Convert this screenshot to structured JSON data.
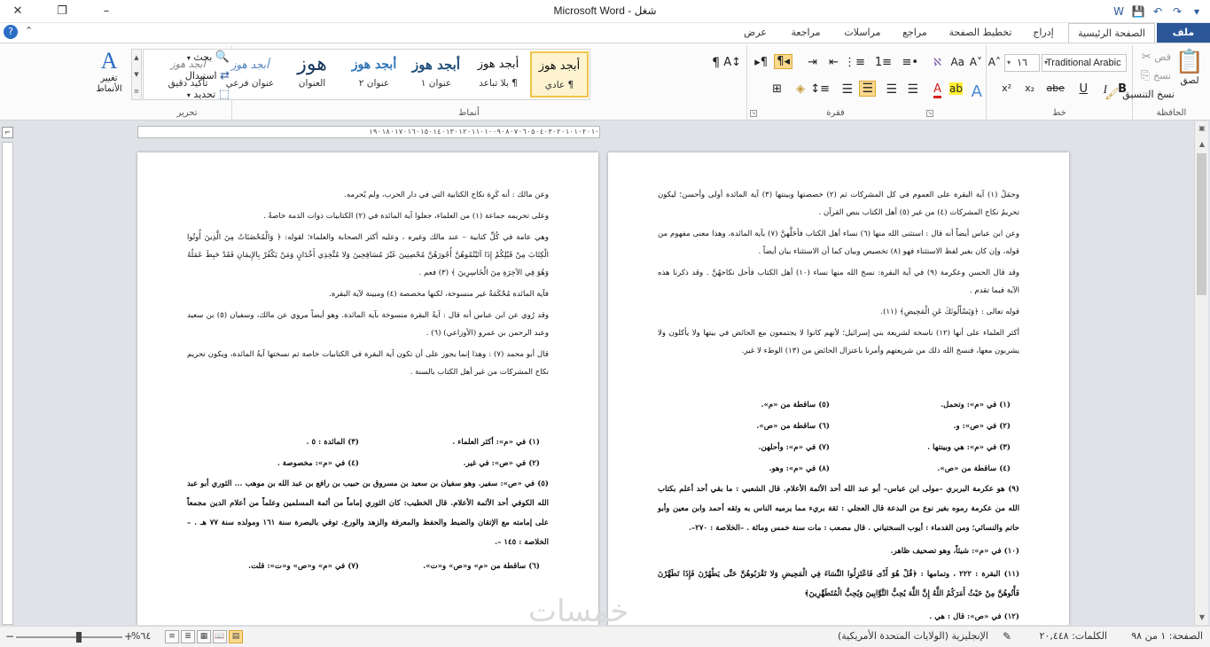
{
  "window": {
    "title": "شغل  -  Microsoft Word"
  },
  "tabs": [
    {
      "label": "ملف",
      "key": "file"
    },
    {
      "label": "الصفحة الرئيسية",
      "key": "home"
    },
    {
      "label": "إدراج",
      "key": "insert"
    },
    {
      "label": "تخطيط الصفحة",
      "key": "layout"
    },
    {
      "label": "مراجع",
      "key": "references"
    },
    {
      "label": "مراسلات",
      "key": "mailings"
    },
    {
      "label": "مراجعة",
      "key": "review"
    },
    {
      "label": "عرض",
      "key": "view"
    }
  ],
  "ribbon": {
    "clipboard": {
      "label": "الحافظة",
      "paste": "لصق",
      "cut": "قص",
      "copy": "نسخ",
      "format_painter": "نسخ التنسيق"
    },
    "font": {
      "label": "خط",
      "font_name": "Traditional Arabic",
      "font_size": "١٦",
      "bold": "B",
      "italic": "I",
      "underline": "U",
      "strike": "abe",
      "subscript": "x₂",
      "superscript": "x²"
    },
    "paragraph": {
      "label": "فقرة"
    },
    "styles": {
      "label": "أنماط",
      "items": [
        {
          "sample": "أبجد هوز",
          "name": "¶ عادي"
        },
        {
          "sample": "أبجد هوز",
          "name": "¶ بلا تباعد"
        },
        {
          "sample": "أبجد هوز",
          "name": "عنوان ١"
        },
        {
          "sample": "أبجد هوز",
          "name": "عنوان ٢"
        },
        {
          "sample": "هوز",
          "name": "العنوان"
        },
        {
          "sample": "أبجد هوز",
          "name": "عنوان فرعي"
        },
        {
          "sample": "أبجد هوز",
          "name": "تأكيد دقيق"
        }
      ],
      "change_styles": "تغيير الأنماط"
    },
    "editing": {
      "label": "تحرير",
      "find": "بحث",
      "replace": "استبدال",
      "select": "تحديد"
    }
  },
  "ruler": {
    "text": "١٩٠١٨٠١٧٠١٦٠١٥٠١٤٠١٣٠١٢٠١١٠١٠٠٩٠٨٠٧٠٦٠٥٠٤٠٣٠٢٠١٠١٠٢٠١٠"
  },
  "pages": {
    "right": {
      "paragraphs": [
        "وحمَلُ (١) آية البقرة على العموم في كل المشركات ثم (٢) خصصتها وبينتها (٣) آية المائدة أولى وأحسن؛ ليكون تحريمُ نكاح المشركات (٤) من غير (٥) أهل الكتاب بنص القرآن .",
        "وعن ابن عباس أيضاً أنه قال : استثنى الله منها (٦) نساء أهل الكتاب فأحَلَّهنَّ (٧) بآية المائدة، وهذا معنى مفهوم من قوله، وإن كان بغير لفظ الاستثناء فهو (٨) تخصيص وبيان كما أن الاستثناء بيان أيضاً .",
        "وقد قال الحسن وعكرمة (٩) في آية البقرة: نسخ الله منها نساء (١٠) أهل الكتاب فأحل نكاحهُنَّ . وقد ذكرنا هذه الآية فيما تقدم .",
        "قوله تعالى : ﴿وَيَسْأَلُونَكَ عَنِ الْمَحِيضِ﴾ (١١).",
        "أكثر العلماء على أنها (١٢) ناسخة لشريعة بني إسرائيل؛ لأنهم كانوا لا يجتمعون مع الحائض في بيتها ولا يأكلون ولا يشربون معها، فنسخ الله ذلك من شريعتهم وأمرنا باعتزال الحائض من (١٣) الوطء لا غير."
      ],
      "footnotes": [
        "(١) في «م»: وتحمل.",
        "(٥) ساقطة من «م».",
        "(٢) في «ص»: و.",
        "(٦) ساقطة من «ص».",
        "(٣) في «م»: هي وبينتها .",
        "(٧) في «م»: وأحلهن.",
        "(٤) ساقطة من «ص».",
        "(٨) في «م»: وهو."
      ],
      "long_notes": [
        "(٩) هو عكرمة البربري –مولى ابن عباس– أبو عبد الله أحد الأئمة الأعلام. قال الشعبي : ما بقي أحد أعلم بكتاب الله من عكرمة رموه بغير نوع من البدعة قال العجلي : ثقة بريء مما يرميه الناس به وثقه أحمد وابن معين وأبو حاتم والنسائي؛ ومن القدماء : أيوب السختياني . قال مصعب : مات سنة خمس ومائة . –الخلاصة : ٢٧٠–.",
        "(١٠) في «م»: شيئاً، وهو تصحيف ظاهر.",
        "(١١) البقرة : ٢٢٢ ، وتمامها : ﴿قُلْ هُوَ أَذًى فَاعْتَزِلُوا النِّسَاءَ فِي الْمَحِيضِ وَلا تَقْرَبُوهُنَّ حَتَّى يَطْهُرْنَ فَإِذَا تَطَهَّرْنَ فَأْتُوهُنَّ مِنْ حَيْثُ أَمَرَكُمُ اللَّهُ إِنَّ اللَّهَ يُحِبُّ التَّوَّابِينَ وَيُحِبُّ الْمُتَطَهِّرِينَ﴾",
        "(١٢) في «ص»: قال : هي ."
      ]
    },
    "left": {
      "paragraphs": [
        "وعن مالك : أنه كَرِهَ نكاح الكتابية التي في دار الحرب، ولم يُحرمه.",
        "وعلى تحريمه جماعة (١) من العلماء، جعلوا آية المائدة في (٢) الكتابيات ذوات الذمة خاصةً .",
        "وهي عامة في كُلِّ كتابية – عند مالك وغيره ، وعليه أكثر الصحابة والعلماء؛ لقوله: ﴿ وَالْمُحْصَنَاتُ مِنَ الَّذِينَ أُوتُوا الْكِتَابَ مِنْ قَبْلِكُمْ إِذَا آتَيْتُمُوهُنَّ أُجُورَهُنَّ مُحْصِنِينَ غَيْرَ مُسَافِحِينَ وَلا مُتَّخِذِي أَخْدَانٍ وَمَنْ يَكْفُرْ بِالإِيمَانِ فَقَدْ حَبِطَ عَمَلُهُ وَهُوَ فِي الآخِرَةِ مِنَ الْخَاسِرِينَ ﴾ (٣) فعم .",
        "فآية المائدة مُحْكَمَةٌ غير منسوخة، لكنها مخصصة (٤) ومبينة لآية البقرة.",
        "وقد رُوي عن ابن عباس أنه قال : آيةُ البقرة منسوخة بآية المائدة. وهو أيضاً مروي عن مالك، وسفيان (٥) بن سعيد وعبد الرحمن بن عمرو (الأوزاعي) (٦) .",
        "قال أبو محمد (٧) : وهذا إنما يجوز على أن تكون آية البقرة في الكتابيات خاصة ثم نسختها آيةُ المائدة، ويكون تحريم نكاح المشركات من غير أهل الكتاب بالسنة ."
      ],
      "footnotes": [
        "(١) في «م»: أكثر العلماء .",
        "(٣) المائدة : ٥ .",
        "(٢) في «ص»: في غير.",
        "(٤) في «م»: مخصوصة ."
      ],
      "long_notes": [
        "(٥) في «ص»: سفير. وهو سفيان بن سعيد بن مسروق بن حبيب بن رافع بن عبد الله بن موهب ... الثوري أبو عبد الله الكوفي أحد الأئمة الأعلام. قال الخطيب: كان الثوري إماماً من أئمة المسلمين وعلماً من أعلام الدين مجمعاً على إمامته مع الإتقان والضبط والحفظ والمعرفة والزهد والورع. توفي بالبصرة سنة ١٦١ ومولده سنة ٧٧ هـ . –الخلاصة : ١٤٥ –."
      ],
      "footnotes2": [
        "(٦) ساقطة من «م» و«ص» و«ت».",
        "(٧) في «م» و«ص» و«ت»: قلت."
      ]
    }
  },
  "statusbar": {
    "page": "الصفحة: ١ من ٩٨",
    "words": "الكلمات: ٢٠,٤٤٨",
    "language": "الإنجليزية (الولايات المتحدة الأمريكية)",
    "zoom": "٦٤%"
  },
  "watermark": "خمسات",
  "colors": {
    "file_tab": "#2b579a",
    "accent": "#2b579a",
    "style_selected": "#f0c44c"
  }
}
